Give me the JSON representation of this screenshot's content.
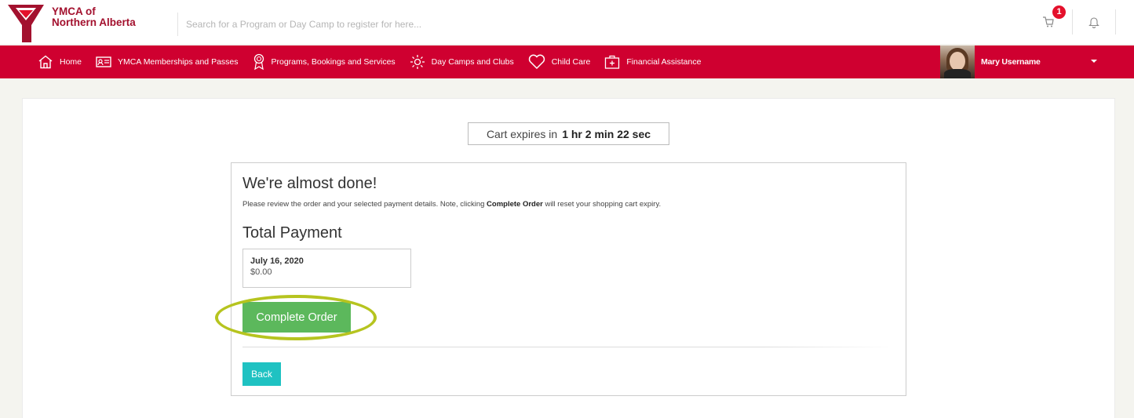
{
  "header": {
    "logo_line1": "YMCA of",
    "logo_line2": "Northern Alberta",
    "search_placeholder": "Search for a Program or Day Camp to register for here...",
    "cart_count": "1"
  },
  "nav": {
    "items": [
      {
        "label": "Home",
        "icon": "home-icon"
      },
      {
        "label": "YMCA Memberships and Passes",
        "icon": "id-card-icon"
      },
      {
        "label": "Programs, Bookings and Services",
        "icon": "award-ribbon-icon"
      },
      {
        "label": "Day Camps and Clubs",
        "icon": "sun-icon"
      },
      {
        "label": "Child Care",
        "icon": "heart-icon"
      },
      {
        "label": "Financial Assistance",
        "icon": "medical-plus-icon"
      }
    ],
    "user_name": "Mary Username"
  },
  "main": {
    "timer_prefix": "Cart expires in",
    "timer_value": "1 hr 2 min 22 sec",
    "heading": "We're almost done!",
    "note_before": "Please review the order and your selected payment details. Note, clicking ",
    "note_bold": "Complete Order",
    "note_after": " will reset your shopping cart expiry.",
    "total_title": "Total Payment",
    "payment_date": "July 16, 2020",
    "payment_amount": "$0.00",
    "complete_label": "Complete Order",
    "back_label": "Back"
  },
  "colors": {
    "brand_red": "#cf0030",
    "complete_green": "#5cb85c",
    "back_teal": "#1fc2c2",
    "highlight_ring": "#b6c41f"
  }
}
